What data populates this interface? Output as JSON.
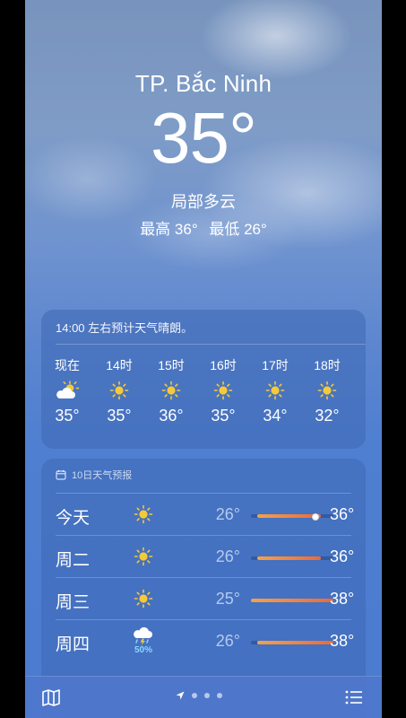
{
  "location": "TP. Bắc Ninh",
  "current": {
    "temp": "35°",
    "condition": "局部多云",
    "high": "最高 36°",
    "low": "最低 26°"
  },
  "hourly": {
    "note": "14:00 左右预计天气晴朗。",
    "items": [
      {
        "label": "现在",
        "icon": "partly-cloudy-icon",
        "temp": "35°"
      },
      {
        "label": "14时",
        "icon": "sun-icon",
        "temp": "35°"
      },
      {
        "label": "15时",
        "icon": "sun-icon",
        "temp": "36°"
      },
      {
        "label": "16时",
        "icon": "sun-icon",
        "temp": "35°"
      },
      {
        "label": "17时",
        "icon": "sun-icon",
        "temp": "34°"
      },
      {
        "label": "18时",
        "icon": "sun-icon",
        "temp": "32°"
      }
    ]
  },
  "daily": {
    "title": "10日天气预报",
    "week_range": [
      25,
      38
    ],
    "current_temp": 35,
    "rows": [
      {
        "day": "今天",
        "icon": "sun-icon",
        "pop": "",
        "low": "26°",
        "high": "36°",
        "low_val": 26,
        "high_val": 36
      },
      {
        "day": "周二",
        "icon": "sun-icon",
        "pop": "",
        "low": "26°",
        "high": "36°",
        "low_val": 26,
        "high_val": 36
      },
      {
        "day": "周三",
        "icon": "sun-icon",
        "pop": "",
        "low": "25°",
        "high": "38°",
        "low_val": 25,
        "high_val": 38
      },
      {
        "day": "周四",
        "icon": "thunderstorm-rain-icon",
        "pop": "50%",
        "low": "26°",
        "high": "38°",
        "low_val": 26,
        "high_val": 38
      }
    ]
  },
  "colors": {
    "bar_cool": "#8fd06a",
    "bar_warm": "#f3a248",
    "bar_hot": "#ea6a3c",
    "pop": "#8ad6ff"
  },
  "bottom_bar": {
    "left_icon": "map-icon",
    "right_icon": "list-icon",
    "page_count": 3,
    "current_page": 0
  }
}
